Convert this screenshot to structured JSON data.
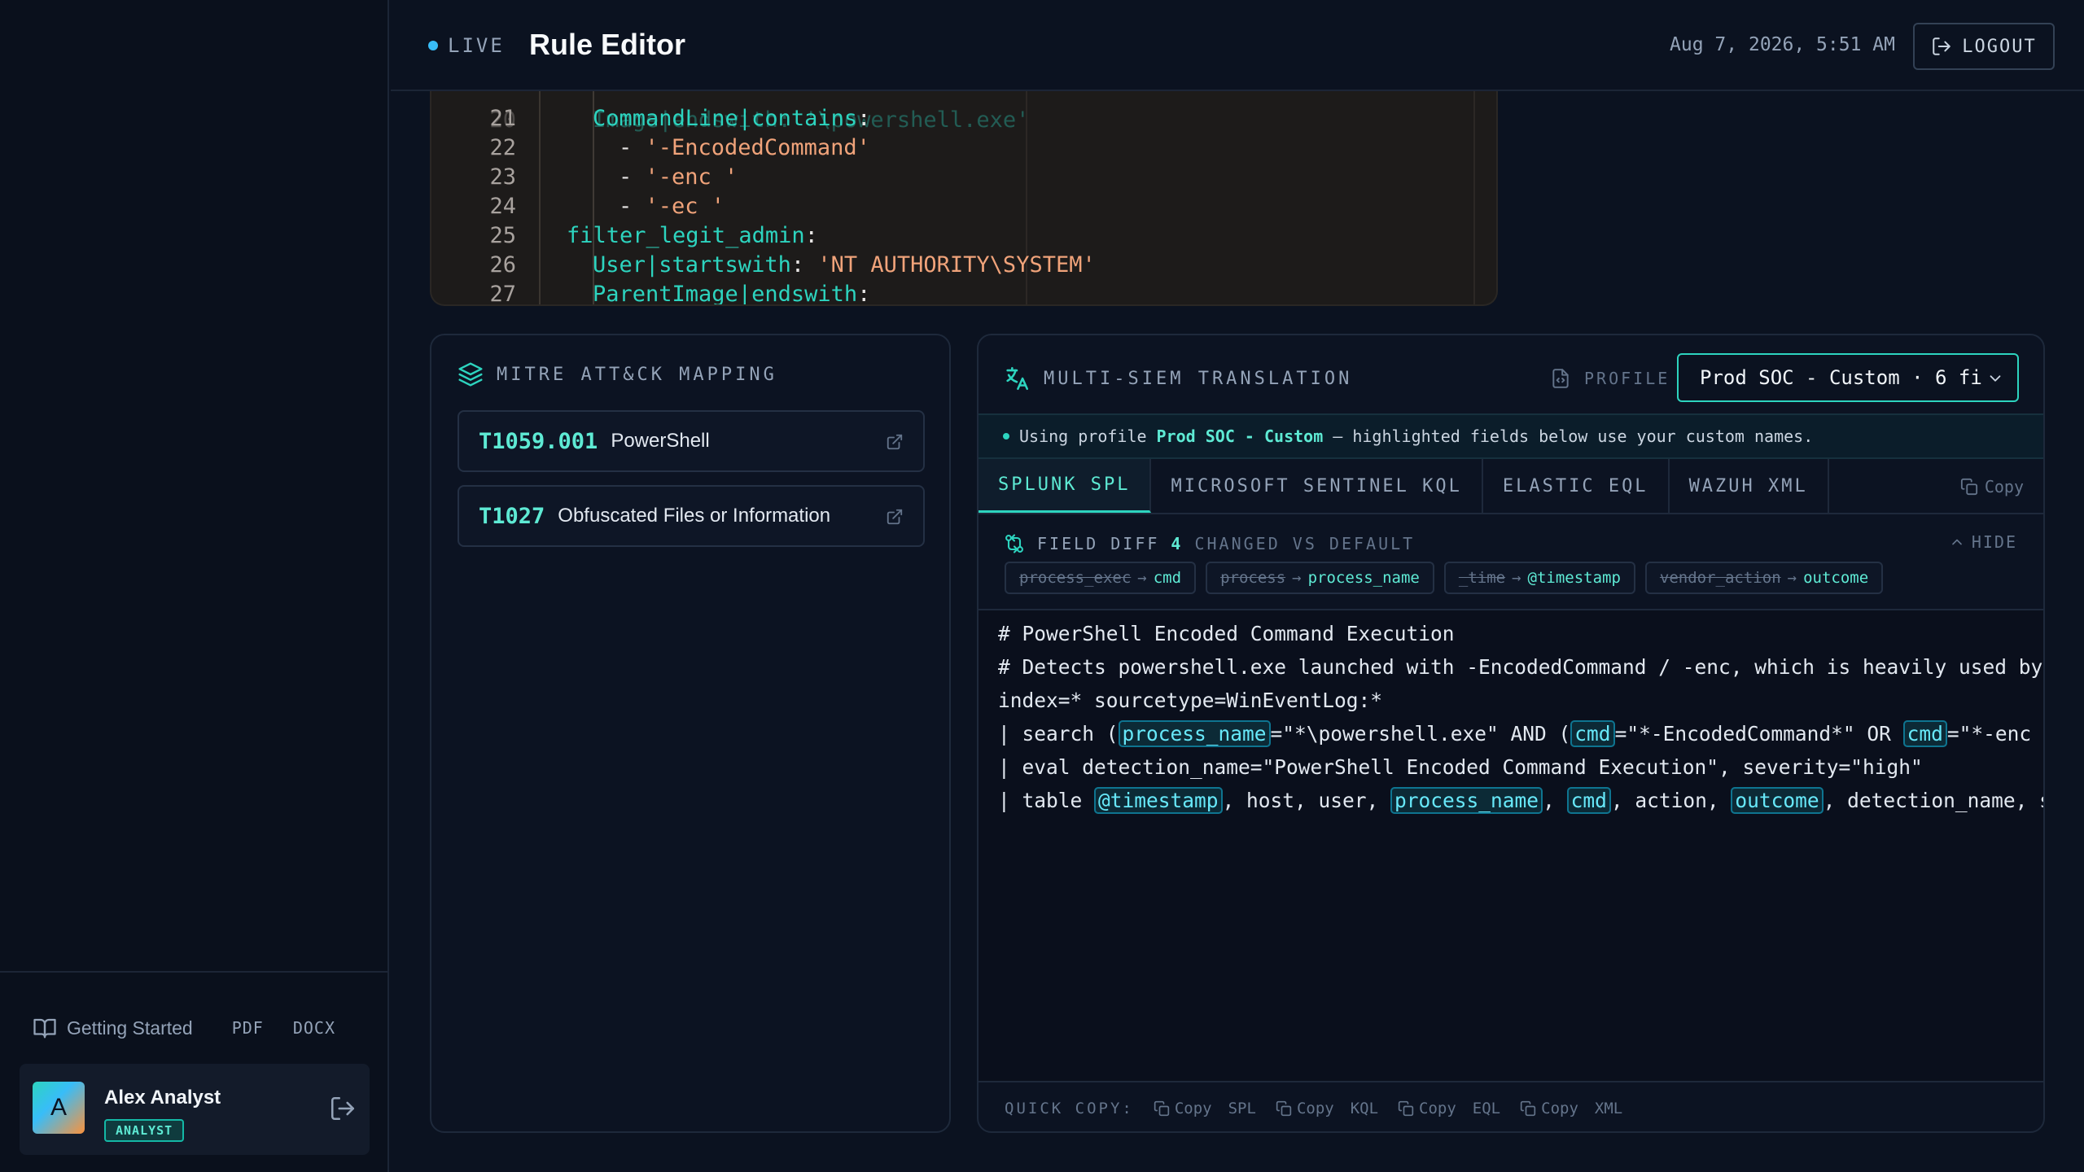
{
  "header": {
    "live_label": "LIVE",
    "title": "Rule Editor",
    "timestamp": "Aug 7, 2026, 5:51 AM",
    "logout_label": "LOGOUT"
  },
  "sidebar": {
    "getting_started": "Getting Started",
    "pdf": "PDF",
    "docx": "DOCX",
    "user": {
      "initial": "A",
      "name": "Alex Analyst",
      "role": "ANALYST"
    }
  },
  "editor": {
    "partial_top": "Image|endswith: '\\powershell.exe'",
    "lines": [
      {
        "n": "21",
        "parts": [
          [
            "k",
            "CommandLine|contains"
          ],
          [
            "p",
            ":"
          ]
        ]
      },
      {
        "n": "22",
        "parts": [
          [
            "p",
            "- "
          ],
          [
            "s",
            "'-EncodedCommand'"
          ]
        ]
      },
      {
        "n": "23",
        "parts": [
          [
            "p",
            "- "
          ],
          [
            "s",
            "'-enc '"
          ]
        ]
      },
      {
        "n": "24",
        "parts": [
          [
            "p",
            "- "
          ],
          [
            "s",
            "'-ec '"
          ]
        ]
      },
      {
        "n": "25",
        "parts": [
          [
            "k",
            "filter_legit_admin"
          ],
          [
            "p",
            ":"
          ]
        ]
      },
      {
        "n": "26",
        "parts": [
          [
            "k",
            "User|startswith"
          ],
          [
            "p",
            ": "
          ],
          [
            "s",
            "'NT AUTHORITY\\SYSTEM'"
          ]
        ]
      },
      {
        "n": "27",
        "parts": [
          [
            "k",
            "ParentImage|endswith"
          ],
          [
            "p",
            ":"
          ]
        ]
      }
    ]
  },
  "mitre": {
    "title": "MITRE ATT&CK MAPPING",
    "techniques": [
      {
        "id": "T1059.001",
        "name": "PowerShell"
      },
      {
        "id": "T1027",
        "name": "Obfuscated Files or Information"
      }
    ]
  },
  "siem": {
    "title": "MULTI-SIEM TRANSLATION",
    "profile_label": "PROFILE",
    "profile_value": "Prod SOC - Custom · 6 fi",
    "notice_prefix": "Using profile",
    "notice_profile": "Prod SOC - Custom",
    "notice_suffix": "— highlighted fields below use your custom names.",
    "tabs": [
      "SPLUNK SPL",
      "MICROSOFT SENTINEL KQL",
      "ELASTIC EQL",
      "WAZUH XML"
    ],
    "copy_label": "Copy",
    "diff": {
      "title": "FIELD DIFF",
      "count": "4",
      "subtitle": "CHANGED VS DEFAULT",
      "hide_label": "HIDE",
      "chips": [
        {
          "from": "process_exec",
          "to": "cmd"
        },
        {
          "from": "process",
          "to": "process_name"
        },
        {
          "from": "_time",
          "to": "@timestamp"
        },
        {
          "from": "vendor_action",
          "to": "outcome"
        }
      ]
    },
    "query_lines": [
      [
        [
          "t",
          "# PowerShell Encoded Command Execution"
        ]
      ],
      [
        [
          "t",
          "# Detects powershell.exe launched with -EncodedCommand / -enc, which is heavily used by r"
        ]
      ],
      [
        [
          "t",
          "index=* sourcetype=WinEventLog:*"
        ]
      ],
      [
        [
          "t",
          "| search ("
        ],
        [
          "f",
          "process_name"
        ],
        [
          "t",
          "=\"*\\powershell.exe\" AND ("
        ],
        [
          "f",
          "cmd"
        ],
        [
          "t",
          "=\"*-EncodedCommand*\" OR "
        ],
        [
          "f",
          "cmd"
        ],
        [
          "t",
          "=\"*-enc *"
        ]
      ],
      [
        [
          "t",
          "| eval detection_name=\"PowerShell Encoded Command Execution\", severity=\"high\""
        ]
      ],
      [
        [
          "t",
          "| table "
        ],
        [
          "f",
          "@timestamp"
        ],
        [
          "t",
          ", host, user, "
        ],
        [
          "f",
          "process_name"
        ],
        [
          "t",
          ", "
        ],
        [
          "f",
          "cmd"
        ],
        [
          "t",
          ", action, "
        ],
        [
          "f",
          "outcome"
        ],
        [
          "t",
          ", detection_name, s"
        ]
      ]
    ],
    "quick_copy": {
      "label": "QUICK COPY:",
      "items": [
        {
          "copy": "Copy",
          "fmt": "SPL"
        },
        {
          "copy": "Copy",
          "fmt": "KQL"
        },
        {
          "copy": "Copy",
          "fmt": "EQL"
        },
        {
          "copy": "Copy",
          "fmt": "XML"
        }
      ]
    }
  },
  "colors": {
    "accent": "#2dd4bf",
    "background": "#0b1220",
    "panel": "#0c1322",
    "code_bg": "#1d1b1a"
  },
  "icons": [
    "book-icon",
    "logout-icon",
    "layers-icon",
    "external-link-icon",
    "translate-icon",
    "file-code-icon",
    "chevron-down-icon",
    "copy-icon",
    "diff-icon",
    "chevron-up-icon"
  ]
}
